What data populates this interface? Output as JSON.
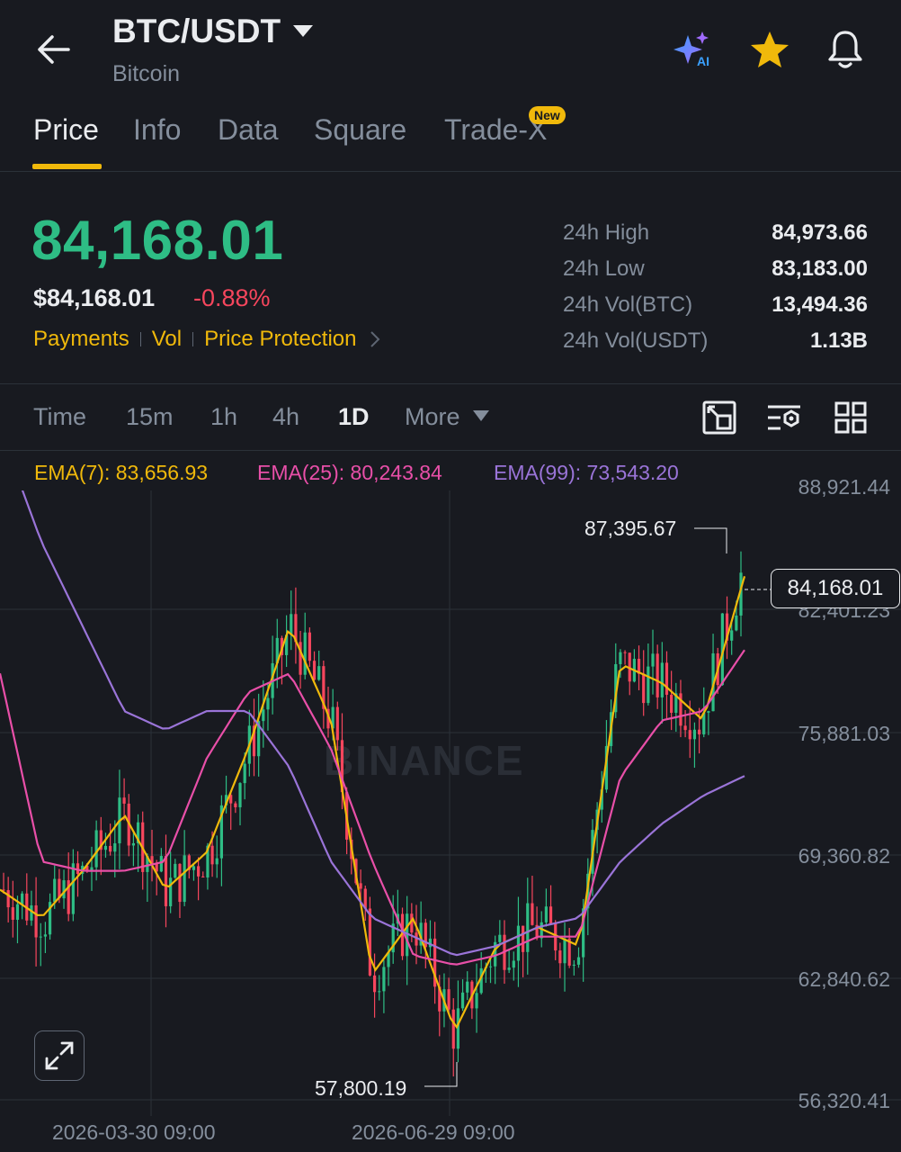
{
  "header": {
    "pair": "BTC/USDT",
    "name": "Bitcoin",
    "icons": [
      "back-arrow-icon",
      "ai-sparkle-icon",
      "star-icon",
      "bell-icon"
    ]
  },
  "tabs": [
    {
      "label": "Price",
      "active": true
    },
    {
      "label": "Info"
    },
    {
      "label": "Data"
    },
    {
      "label": "Square"
    },
    {
      "label": "Trade-X",
      "badge": "New"
    }
  ],
  "price": {
    "last": "84,168.01",
    "usd": "$84,168.01",
    "change": "-0.88%",
    "links": [
      "Payments",
      "Vol",
      "Price Protection"
    ]
  },
  "stats": [
    {
      "label": "24h High",
      "value": "84,973.66"
    },
    {
      "label": "24h Low",
      "value": "83,183.00"
    },
    {
      "label": "24h Vol(BTC)",
      "value": "13,494.36"
    },
    {
      "label": "24h Vol(USDT)",
      "value": "1.13B"
    }
  ],
  "timeframes": {
    "items": [
      "Time",
      "15m",
      "1h",
      "4h",
      "1D",
      "More"
    ],
    "active": "1D",
    "tool_icons": [
      "fullscreen-chart-icon",
      "indicator-settings-icon",
      "grid-layout-icon"
    ]
  },
  "indicators": {
    "ema7": "EMA(7): 83,656.93",
    "ema25": "EMA(25): 80,243.84",
    "ema99": "EMA(99): 73,543.20"
  },
  "colors": {
    "up": "#2ebd85",
    "down": "#f6465d",
    "accent": "#f0b90b",
    "ema7": "#f0b90b",
    "ema25": "#e84fa8",
    "ema99": "#9a74d8"
  },
  "chart_data": {
    "type": "candlestick",
    "y_ticks": [
      "88,921.44",
      "82,401.23",
      "75,881.03",
      "69,360.82",
      "62,840.62",
      "56,320.41"
    ],
    "x_ticks": [
      "2026-03-30 09:00",
      "2026-06-29 09:00"
    ],
    "ylim": [
      56320.41,
      88921.44
    ],
    "high_annotation": "87,395.67",
    "low_annotation": "57,800.19",
    "last_price_tag": "84,168.01",
    "watermark": "BINANCE",
    "series": [
      {
        "name": "EMA(7)",
        "values": [
          67500,
          66000,
          68500,
          71500,
          67500,
          69500,
          75000,
          81500,
          76500,
          63000,
          66000,
          60000,
          64500,
          65500,
          64500,
          79500,
          78500,
          76500,
          84168
        ]
      },
      {
        "name": "EMA(25)",
        "values": [
          79000,
          69000,
          68500,
          68500,
          69000,
          74500,
          78000,
          79000,
          75000,
          69000,
          64000,
          63500,
          64000,
          65000,
          65000,
          73500,
          76500,
          77000,
          80244
        ]
      },
      {
        "name": "EMA(99)",
        "values": [
          92000,
          86000,
          81500,
          77000,
          76000,
          77000,
          77000,
          74000,
          69000,
          66000,
          65000,
          64000,
          64500,
          65500,
          66000,
          69000,
          71000,
          72500,
          73543
        ]
      }
    ]
  }
}
